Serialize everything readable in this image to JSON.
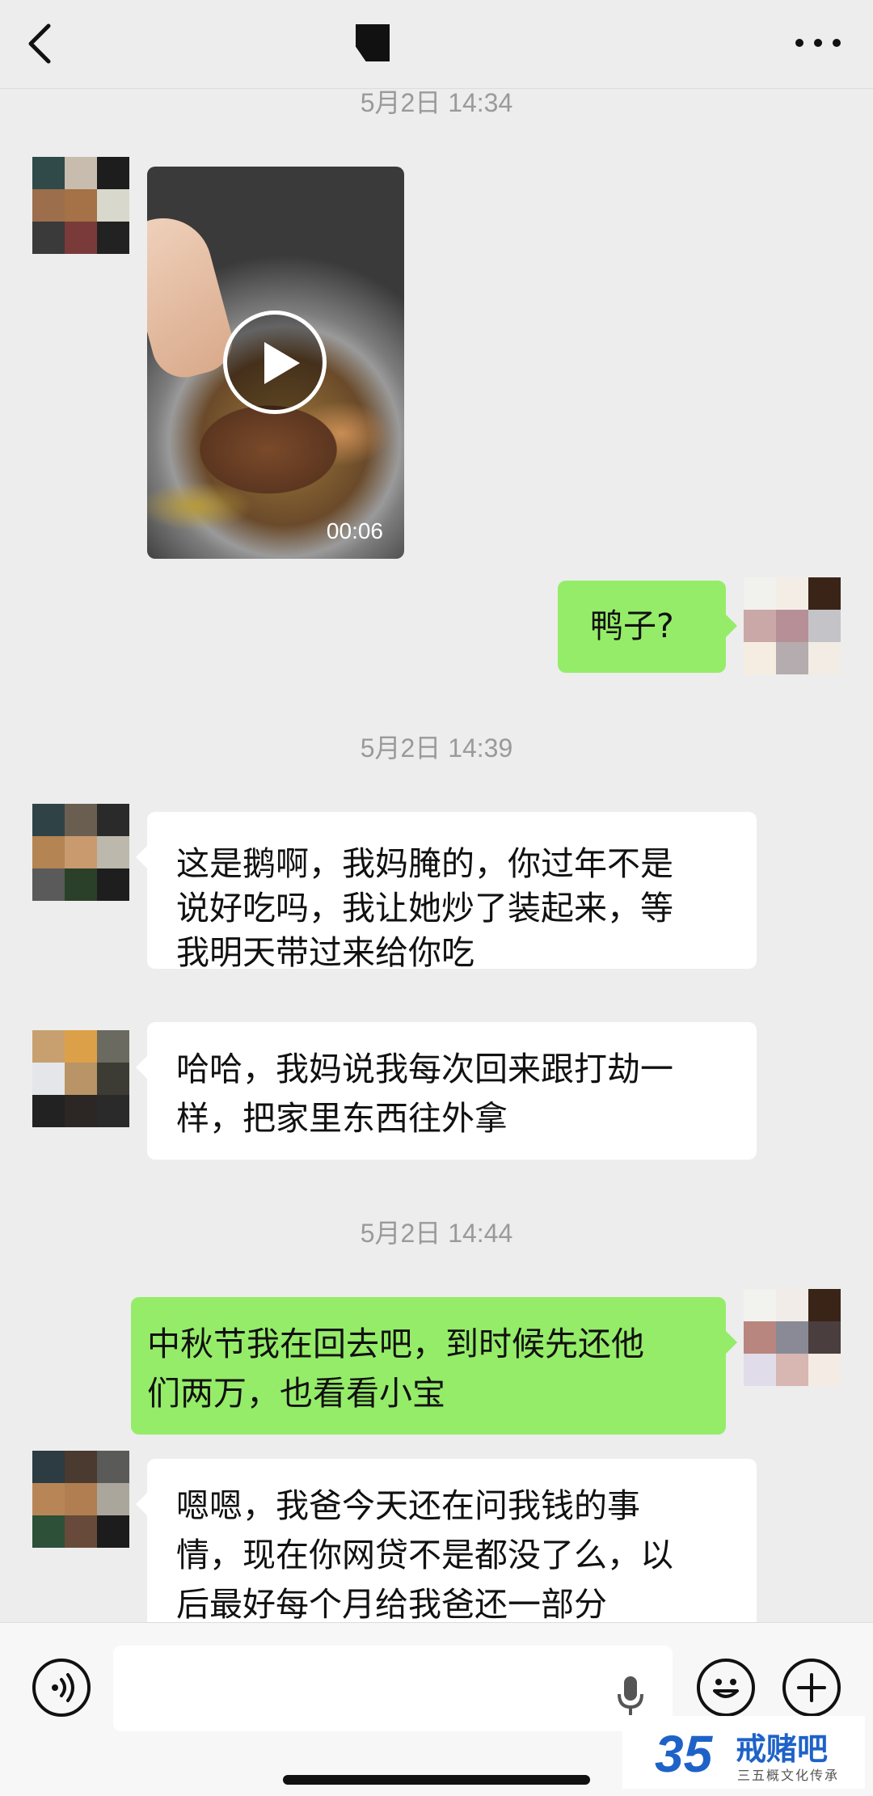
{
  "header": {
    "title": ""
  },
  "messages": {
    "ts_top": "5月2日 14:34",
    "video_duration": "00:06",
    "m1": "鸭子?",
    "ts2": "5月2日 14:39",
    "m2_line1": "这是鹅啊，我妈腌的，你过年不是",
    "m2_line2": "说好吃吗，我让她炒了装起来，等",
    "m2_line3": "我明天带过来给你吃",
    "m3_line1": "哈哈，我妈说我每次回来跟打劫一",
    "m3_line2": "样，把家里东西往外拿",
    "ts3": "5月2日 14:44",
    "m4_line1": "中秋节我在回去吧，到时候先还他",
    "m4_line2": "们两万，也看看小宝",
    "m5_line1": "嗯嗯，我爸今天还在问我钱的事",
    "m5_line2": "情，现在你网贷不是都没了么，以",
    "m5_line3": "后最好每个月给我爸还一部分"
  },
  "watermark": {
    "logo": "35",
    "name": "戒赌吧",
    "sub": "三五概文化传承"
  },
  "icons": {
    "back": "chevron-left-icon",
    "more": "more-icon",
    "voice": "voice-icon",
    "emoji": "emoji-icon",
    "plus": "plus-icon",
    "mic": "mic-icon",
    "play": "play-icon"
  },
  "colors": {
    "incoming": "#ffffff",
    "outgoing": "#95ec69",
    "background": "#ededed"
  }
}
